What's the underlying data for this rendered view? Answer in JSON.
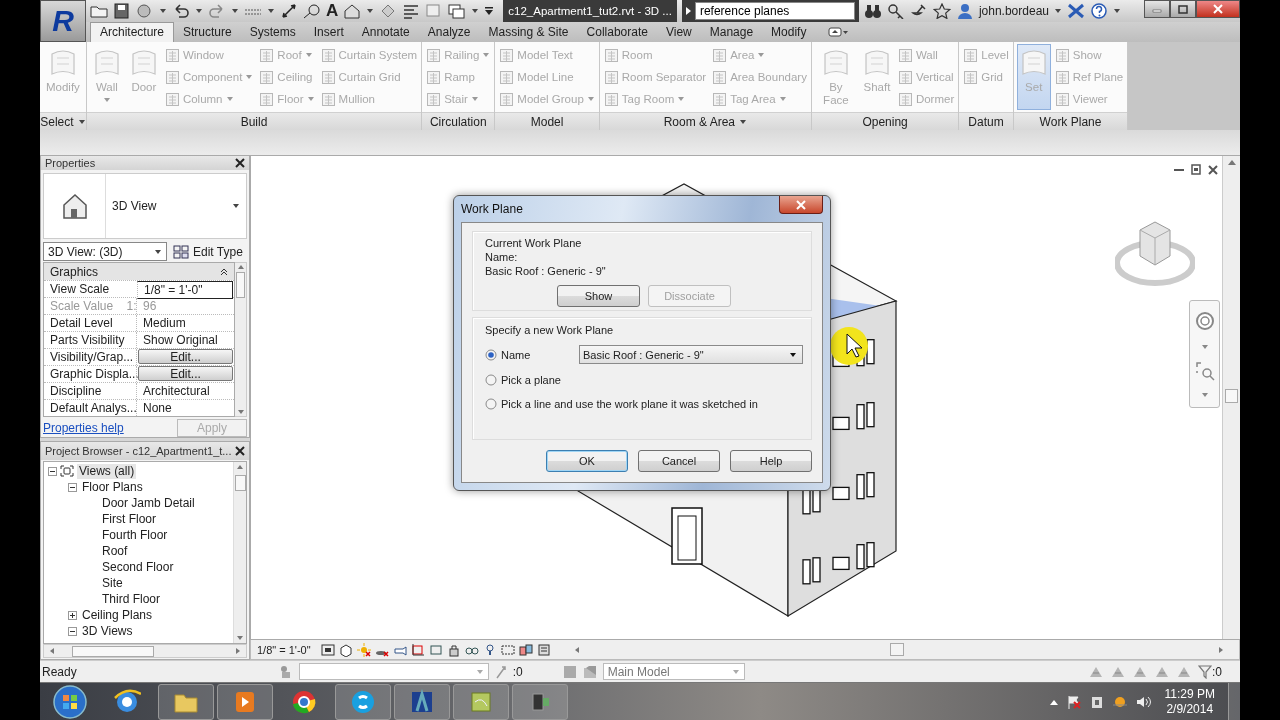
{
  "application_button": "R",
  "title_bar": {
    "text_tool_glyph": "A",
    "document_title": "c12_Apartment1_tut2.rvt - 3D ...",
    "search": {
      "value": "reference planes"
    },
    "user": "john.bordeau"
  },
  "tabs": [
    {
      "label": "Architecture",
      "selected": true
    },
    {
      "label": "Structure",
      "selected": false
    },
    {
      "label": "Systems",
      "selected": false
    },
    {
      "label": "Insert",
      "selected": false
    },
    {
      "label": "Annotate",
      "selected": false
    },
    {
      "label": "Analyze",
      "selected": false
    },
    {
      "label": "Massing & Site",
      "selected": false
    },
    {
      "label": "Collaborate",
      "selected": false
    },
    {
      "label": "View",
      "selected": false
    },
    {
      "label": "Manage",
      "selected": false
    },
    {
      "label": "Modify",
      "selected": false
    }
  ],
  "ribbon": {
    "panels": [
      {
        "label": "Select",
        "dropdown": true,
        "large_tools": [
          {
            "label": "Modify",
            "disabled": true,
            "active": false,
            "dropdown": false
          }
        ]
      },
      {
        "label": "Build",
        "dropdown": false,
        "large_tools": [
          {
            "label": "Wall",
            "disabled": true,
            "active": false,
            "dropdown": true
          },
          {
            "label": "Door",
            "disabled": true,
            "active": false,
            "dropdown": false
          }
        ],
        "small_tools": [
          {
            "label": "Window",
            "disabled": true,
            "dropdown": false
          },
          {
            "label": "Component",
            "disabled": true,
            "dropdown": true
          },
          {
            "label": "Column",
            "disabled": true,
            "dropdown": true
          },
          {
            "label": "Roof",
            "disabled": true,
            "dropdown": true
          },
          {
            "label": "Ceiling",
            "disabled": true,
            "dropdown": false
          },
          {
            "label": "Floor",
            "disabled": true,
            "dropdown": true
          },
          {
            "label": "Curtain System",
            "disabled": true,
            "dropdown": false
          },
          {
            "label": "Curtain Grid",
            "disabled": true,
            "dropdown": false
          },
          {
            "label": "Mullion",
            "disabled": true,
            "dropdown": false
          }
        ]
      },
      {
        "label": "Circulation",
        "dropdown": false,
        "small_tools": [
          {
            "label": "Railing",
            "disabled": true,
            "dropdown": true
          },
          {
            "label": "Ramp",
            "disabled": true,
            "dropdown": false
          },
          {
            "label": "Stair",
            "disabled": true,
            "dropdown": true
          }
        ]
      },
      {
        "label": "Model",
        "dropdown": false,
        "small_tools": [
          {
            "label": "Model Text",
            "disabled": true,
            "dropdown": false
          },
          {
            "label": "Model Line",
            "disabled": true,
            "dropdown": false
          },
          {
            "label": "Model Group",
            "disabled": true,
            "dropdown": true
          }
        ]
      },
      {
        "label": "Room & Area",
        "dropdown": true,
        "small_tools": [
          {
            "label": "Room",
            "disabled": true,
            "dropdown": false
          },
          {
            "label": "Room Separator",
            "disabled": true,
            "dropdown": false
          },
          {
            "label": "Tag Room",
            "disabled": true,
            "dropdown": true
          },
          {
            "label": "Area",
            "disabled": true,
            "dropdown": true
          },
          {
            "label": "Area Boundary",
            "disabled": true,
            "dropdown": false
          },
          {
            "label": "Tag Area",
            "disabled": true,
            "dropdown": true
          }
        ]
      },
      {
        "label": "Opening",
        "dropdown": false,
        "large_tools": [
          {
            "label": "By Face",
            "disabled": true,
            "active": false,
            "dropdown": false
          },
          {
            "label": "Shaft",
            "disabled": true,
            "active": false,
            "dropdown": false
          }
        ],
        "small_tools": [
          {
            "label": "Wall",
            "disabled": true,
            "dropdown": false
          },
          {
            "label": "Vertical",
            "disabled": true,
            "dropdown": false
          },
          {
            "label": "Dormer",
            "disabled": true,
            "dropdown": false
          }
        ]
      },
      {
        "label": "Datum",
        "dropdown": false,
        "small_tools": [
          {
            "label": "Level",
            "disabled": true,
            "dropdown": false
          },
          {
            "label": "Grid",
            "disabled": true,
            "dropdown": false
          }
        ]
      },
      {
        "label": "Work Plane",
        "dropdown": false,
        "large_tools": [
          {
            "label": "Set",
            "disabled": true,
            "active": true,
            "dropdown": false
          }
        ],
        "small_tools": [
          {
            "label": "Show",
            "disabled": true,
            "dropdown": false
          },
          {
            "label": "Ref Plane",
            "disabled": true,
            "dropdown": false
          },
          {
            "label": "Viewer",
            "disabled": true,
            "dropdown": false
          }
        ]
      }
    ]
  },
  "properties": {
    "title": "Properties",
    "type_name": "3D View",
    "instance_selector": "3D View: (3D)",
    "edit_type": "Edit Type",
    "group": "Graphics",
    "rows": [
      {
        "label": "View Scale",
        "value": "1/8\" = 1'-0\"",
        "kind": "field"
      },
      {
        "label": "Scale Value    1:",
        "value": "96",
        "kind": "readonly"
      },
      {
        "label": "Detail Level",
        "value": "Medium",
        "kind": "text"
      },
      {
        "label": "Parts Visibility",
        "value": "Show Original",
        "kind": "text"
      },
      {
        "label": "Visibility/Grap...",
        "value": "Edit...",
        "kind": "button"
      },
      {
        "label": "Graphic Displa...",
        "value": "Edit...",
        "kind": "button"
      },
      {
        "label": "Discipline",
        "value": "Architectural",
        "kind": "text"
      },
      {
        "label": "Default Analys...",
        "value": "None",
        "kind": "text"
      }
    ],
    "help_link": "Properties help",
    "apply": {
      "label": "Apply",
      "disabled": true
    }
  },
  "project_browser": {
    "title": "Project Browser - c12_Apartment1_t...",
    "tree": [
      {
        "label": "Views (all)",
        "expanded": true,
        "selected": true,
        "children": [
          {
            "label": "Floor Plans",
            "expanded": true,
            "selected": false,
            "children": [
              {
                "label": "Door Jamb Detail",
                "selected": false
              },
              {
                "label": "First Floor",
                "selected": false
              },
              {
                "label": "Fourth Floor",
                "selected": false
              },
              {
                "label": "Roof",
                "selected": false
              },
              {
                "label": "Second Floor",
                "selected": false
              },
              {
                "label": "Site",
                "selected": false
              },
              {
                "label": "Third Floor",
                "selected": false
              }
            ]
          },
          {
            "label": "Ceiling Plans",
            "expanded": false,
            "selected": false
          },
          {
            "label": "3D Views",
            "expanded": true,
            "selected": false
          }
        ]
      }
    ]
  },
  "dialog": {
    "title": "Work Plane",
    "current": {
      "heading": "Current Work Plane",
      "name_label": "Name:",
      "name_value": "Basic Roof : Generic - 9\"",
      "buttons": [
        {
          "label": "Show",
          "disabled": false
        },
        {
          "label": "Dissociate",
          "disabled": true
        }
      ]
    },
    "specify": {
      "heading": "Specify a new Work Plane",
      "name_select": "Basic Roof : Generic - 9\"",
      "options": [
        {
          "label": "Name",
          "selected": true
        },
        {
          "label": "Pick a plane",
          "selected": false
        },
        {
          "label": "Pick a line and use the work plane it was sketched in",
          "selected": false
        }
      ]
    },
    "buttons": [
      {
        "label": "OK",
        "default": true
      },
      {
        "label": "Cancel",
        "default": false
      },
      {
        "label": "Help",
        "default": false
      }
    ]
  },
  "view_control_bar": {
    "scale": "1/8\" = 1'-0\""
  },
  "status_bar": {
    "message": "Ready",
    "selection_count": ":0",
    "workset": "Main Model",
    "filter_count": ":0"
  },
  "taskbar": {
    "time": "11:29 PM",
    "date": "2/9/2014"
  }
}
